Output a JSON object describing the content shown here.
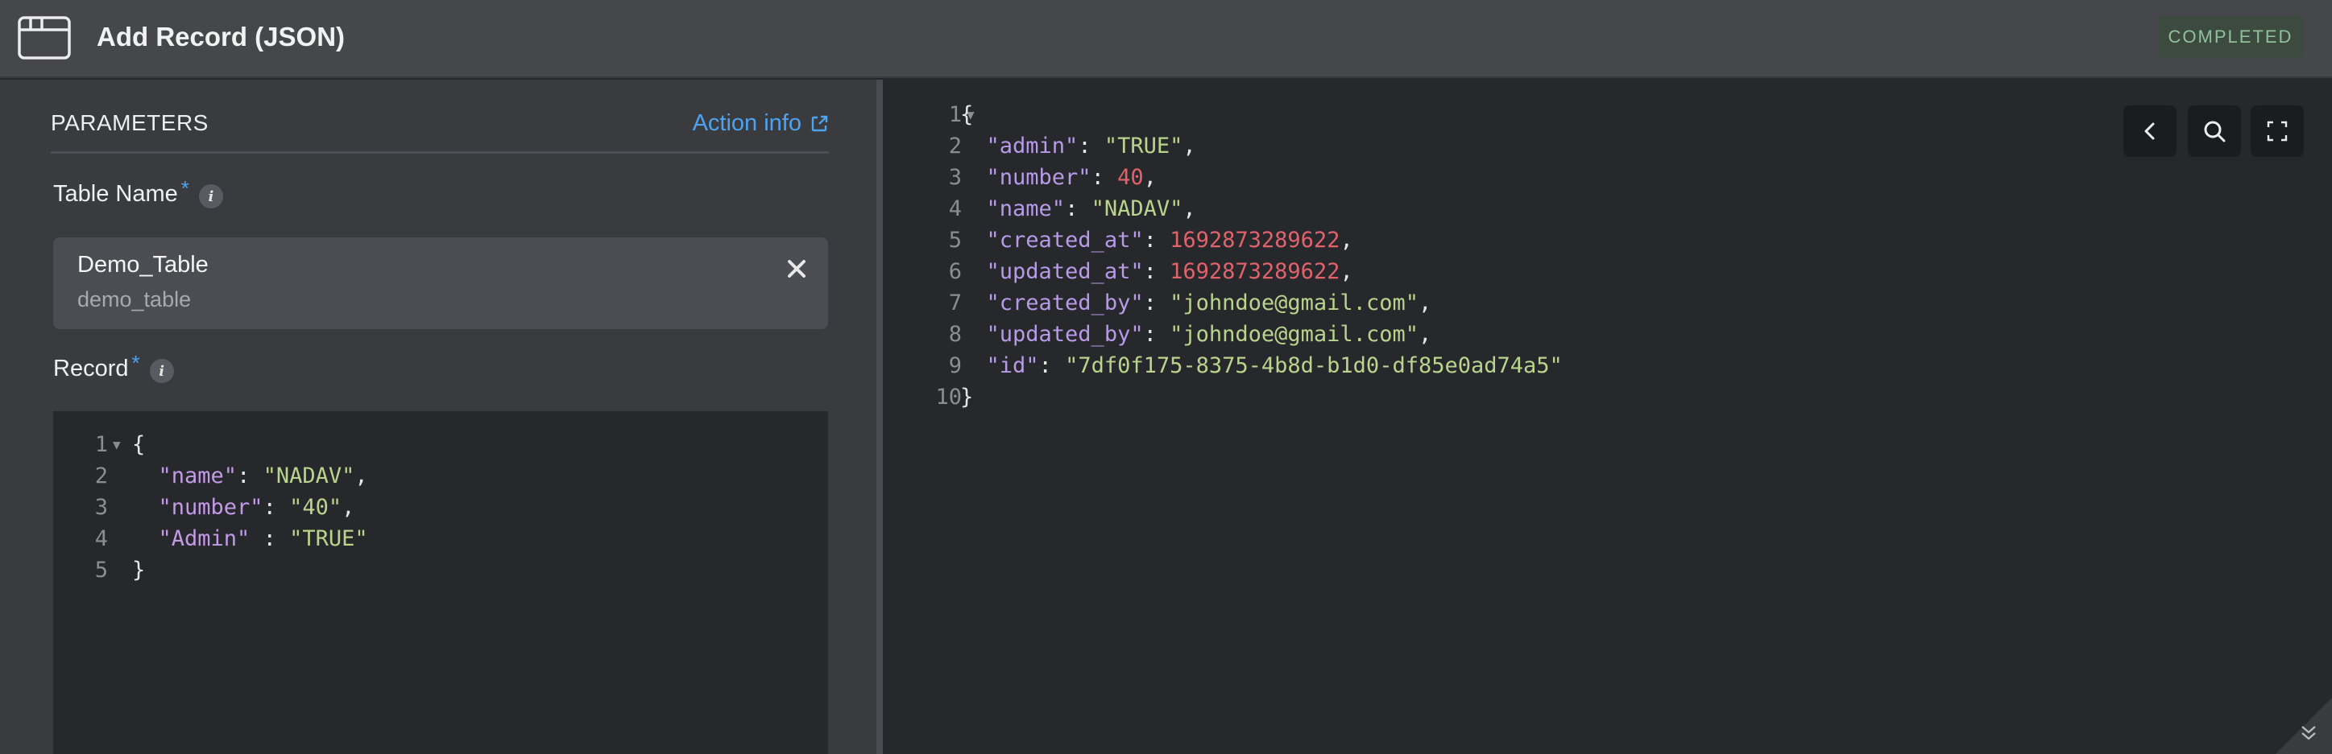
{
  "header": {
    "title": "Add Record (JSON)",
    "status": "COMPLETED",
    "icon": "browser-window-icon"
  },
  "parameters": {
    "title": "PARAMETERS",
    "action_info": "Action info"
  },
  "table_name": {
    "label": "Table Name",
    "required_mark": "*",
    "info": "i",
    "value": "Demo_Table",
    "sub_value": "demo_table"
  },
  "record": {
    "label": "Record",
    "required_mark": "*",
    "info": "i",
    "lines": [
      {
        "n": "1",
        "parts": [
          [
            "{",
            "white"
          ]
        ]
      },
      {
        "n": "2",
        "parts": [
          [
            "  ",
            "white"
          ],
          [
            "\"name\"",
            "purple"
          ],
          [
            ": ",
            "white"
          ],
          [
            "\"NADAV\"",
            "green"
          ],
          [
            ",",
            "white"
          ]
        ]
      },
      {
        "n": "3",
        "parts": [
          [
            "  ",
            "white"
          ],
          [
            "\"number\"",
            "purple"
          ],
          [
            ": ",
            "white"
          ],
          [
            "\"40\"",
            "green"
          ],
          [
            ",",
            "white"
          ]
        ]
      },
      {
        "n": "4",
        "parts": [
          [
            "  ",
            "white"
          ],
          [
            "\"Admin\"",
            "purple"
          ],
          [
            " : ",
            "white"
          ],
          [
            "\"TRUE\"",
            "green"
          ]
        ]
      },
      {
        "n": "5",
        "parts": [
          [
            "}",
            "white"
          ]
        ]
      }
    ]
  },
  "output": {
    "lines": [
      {
        "n": "1",
        "parts": [
          [
            "{",
            "white"
          ]
        ]
      },
      {
        "n": "2",
        "parts": [
          [
            "  ",
            "white"
          ],
          [
            "\"admin\"",
            "blue"
          ],
          [
            ": ",
            "white"
          ],
          [
            "\"TRUE\"",
            "green"
          ],
          [
            ",",
            "white"
          ]
        ]
      },
      {
        "n": "3",
        "parts": [
          [
            "  ",
            "white"
          ],
          [
            "\"number\"",
            "blue"
          ],
          [
            ": ",
            "white"
          ],
          [
            "40",
            "red"
          ],
          [
            ",",
            "white"
          ]
        ]
      },
      {
        "n": "4",
        "parts": [
          [
            "  ",
            "white"
          ],
          [
            "\"name\"",
            "blue"
          ],
          [
            ": ",
            "white"
          ],
          [
            "\"NADAV\"",
            "green"
          ],
          [
            ",",
            "white"
          ]
        ]
      },
      {
        "n": "5",
        "parts": [
          [
            "  ",
            "white"
          ],
          [
            "\"created_at\"",
            "blue"
          ],
          [
            ": ",
            "white"
          ],
          [
            "1692873289622",
            "red"
          ],
          [
            ",",
            "white"
          ]
        ]
      },
      {
        "n": "6",
        "parts": [
          [
            "  ",
            "white"
          ],
          [
            "\"updated_at\"",
            "blue"
          ],
          [
            ": ",
            "white"
          ],
          [
            "1692873289622",
            "red"
          ],
          [
            ",",
            "white"
          ]
        ]
      },
      {
        "n": "7",
        "parts": [
          [
            "  ",
            "white"
          ],
          [
            "\"created_by\"",
            "blue"
          ],
          [
            ": ",
            "white"
          ],
          [
            "\"johndoe@gmail.com\"",
            "green"
          ],
          [
            ",",
            "white"
          ]
        ]
      },
      {
        "n": "8",
        "parts": [
          [
            "  ",
            "white"
          ],
          [
            "\"updated_by\"",
            "blue"
          ],
          [
            ": ",
            "white"
          ],
          [
            "\"johndoe@gmail.com\"",
            "green"
          ],
          [
            ",",
            "white"
          ]
        ]
      },
      {
        "n": "9",
        "parts": [
          [
            "  ",
            "white"
          ],
          [
            "\"id\"",
            "blue"
          ],
          [
            ": ",
            "white"
          ],
          [
            "\"7df0f175-8375-4b8d-b1d0-df85e0ad74a5\"",
            "green"
          ]
        ]
      },
      {
        "n": "10",
        "parts": [
          [
            "}",
            "white"
          ]
        ]
      }
    ]
  },
  "colors": {
    "accent": "#4da3ef",
    "status_bg": "#3d4a40",
    "status_text": "#8fc19a",
    "json_key": "#c39ae8",
    "json_string": "#b9d48c",
    "json_number": "#e0636c"
  },
  "toolbar": {
    "back_icon": "chevron-left-icon",
    "search_icon": "search-icon",
    "fullscreen_icon": "fullscreen-icon"
  }
}
